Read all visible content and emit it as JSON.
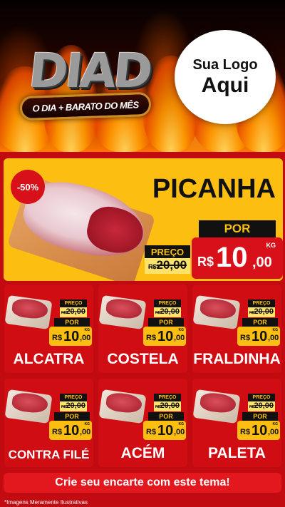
{
  "header": {
    "logo_main": "DIAD",
    "logo_band": "O DIA + BARATO DO MÊS",
    "logo_placeholder_line1": "Sua Logo",
    "logo_placeholder_line2": "Aqui"
  },
  "featured": {
    "discount_badge": "-50%",
    "name": "PICANHA",
    "por_label": "POR",
    "preco_label": "PREÇO",
    "old_currency": "R$",
    "old_value": "20,00",
    "currency": "R$",
    "price_int": "10",
    "price_dec": ",00",
    "unit": "KG",
    "image": "picanha-photo"
  },
  "products": [
    {
      "name": "ALCATRA",
      "preco_label": "PREÇO",
      "old_currency": "R$",
      "old_value": "20,00",
      "por_label": "POR",
      "currency": "R$",
      "price_int": "10",
      "price_dec": ",00",
      "unit": "KG"
    },
    {
      "name": "COSTELA",
      "preco_label": "PREÇO",
      "old_currency": "R$",
      "old_value": "20,00",
      "por_label": "POR",
      "currency": "R$",
      "price_int": "10",
      "price_dec": ",00",
      "unit": "KG"
    },
    {
      "name": "FRALDINHA",
      "preco_label": "PREÇO",
      "old_currency": "R$",
      "old_value": "20,00",
      "por_label": "POR",
      "currency": "R$",
      "price_int": "10",
      "price_dec": ",00",
      "unit": "KG"
    },
    {
      "name": "CONTRA FILÉ",
      "preco_label": "PREÇO",
      "old_currency": "R$",
      "old_value": "20,00",
      "por_label": "POR",
      "currency": "R$",
      "price_int": "10",
      "price_dec": ",00",
      "unit": "KG"
    },
    {
      "name": "ACÉM",
      "preco_label": "PREÇO",
      "old_currency": "R$",
      "old_value": "20,00",
      "por_label": "POR",
      "currency": "R$",
      "price_int": "10",
      "price_dec": ",00",
      "unit": "KG"
    },
    {
      "name": "PALETA",
      "preco_label": "PREÇO",
      "old_currency": "R$",
      "old_value": "20,00",
      "por_label": "POR",
      "currency": "R$",
      "price_int": "10",
      "price_dec": ",00",
      "unit": "KG"
    }
  ],
  "cta": "Crie seu encarte com este tema!",
  "footnote": "*Imagens Meramente Ilustrativas",
  "colors": {
    "background_red": "#c20b10",
    "card_red": "#d10d14",
    "accent_yellow": "#fcbf11",
    "badge_red": "#d8101a"
  }
}
